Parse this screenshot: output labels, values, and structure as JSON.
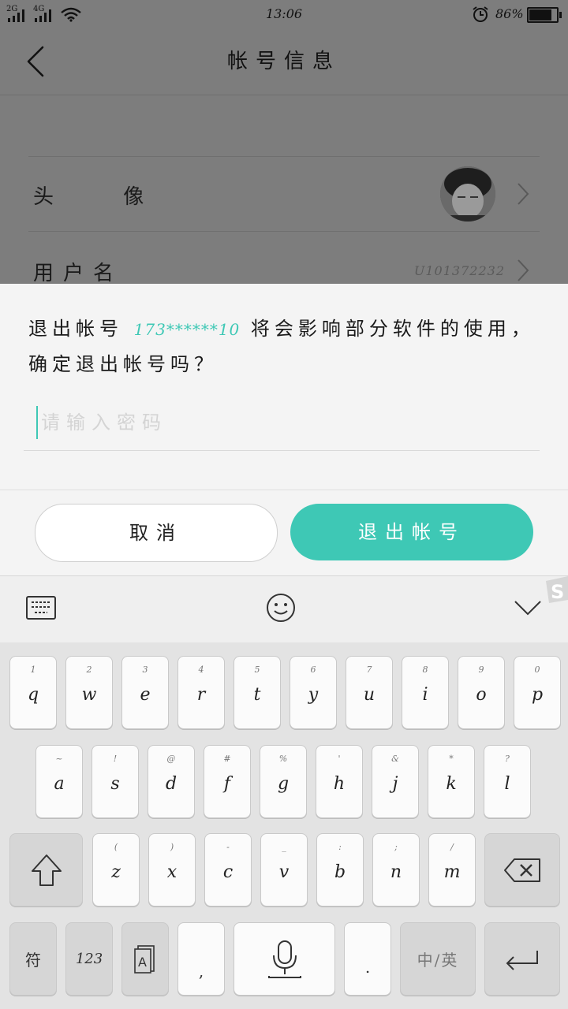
{
  "status": {
    "sim1": "2G",
    "sim2": "4G",
    "time": "13:06",
    "battery": "86%",
    "battery_level": 0.86
  },
  "header": {
    "title": "帐号信息"
  },
  "rows": {
    "avatar_label": "头 像",
    "username_label": "用户名",
    "username_value": "U101372232"
  },
  "dialog": {
    "msg_prefix": "退出帐号 ",
    "account": "173******10",
    "msg_suffix": " 将会影响部分软件的使用，确定退出帐号吗？",
    "password_placeholder": "请输入密码",
    "cancel_label": "取消",
    "logout_label": "退出帐号"
  },
  "keyboard": {
    "row1": [
      {
        "sub": "1",
        "key": "q"
      },
      {
        "sub": "2",
        "key": "w"
      },
      {
        "sub": "3",
        "key": "e"
      },
      {
        "sub": "4",
        "key": "r"
      },
      {
        "sub": "5",
        "key": "t"
      },
      {
        "sub": "6",
        "key": "y"
      },
      {
        "sub": "7",
        "key": "u"
      },
      {
        "sub": "8",
        "key": "i"
      },
      {
        "sub": "9",
        "key": "o"
      },
      {
        "sub": "0",
        "key": "p"
      }
    ],
    "row2": [
      {
        "sub": "~",
        "key": "a"
      },
      {
        "sub": "!",
        "key": "s"
      },
      {
        "sub": "@",
        "key": "d"
      },
      {
        "sub": "#",
        "key": "f"
      },
      {
        "sub": "%",
        "key": "g"
      },
      {
        "sub": "'",
        "key": "h"
      },
      {
        "sub": "&",
        "key": "j"
      },
      {
        "sub": "*",
        "key": "k"
      },
      {
        "sub": "?",
        "key": "l"
      }
    ],
    "row3": [
      {
        "sub": "(",
        "key": "z"
      },
      {
        "sub": ")",
        "key": "x"
      },
      {
        "sub": "-",
        "key": "c"
      },
      {
        "sub": "_",
        "key": "v"
      },
      {
        "sub": ":",
        "key": "b"
      },
      {
        "sub": ";",
        "key": "n"
      },
      {
        "sub": "/",
        "key": "m"
      }
    ],
    "symbol_label": "符",
    "num_label": "123",
    "comma_label": ",",
    "period_label": ".",
    "lang_label": "中/英"
  }
}
